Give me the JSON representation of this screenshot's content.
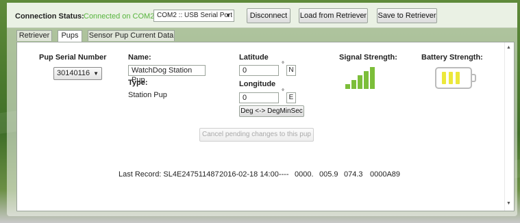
{
  "connection": {
    "label": "Connection Status:",
    "status": "Connected on COM2",
    "port": "COM2 :: USB Serial Port"
  },
  "toolbar": {
    "disconnect_label": "Disconnect",
    "load_label": "Load from Retriever",
    "save_label": "Save to Retriever"
  },
  "tabs": [
    {
      "label": "Retriever",
      "active": false
    },
    {
      "label": "Pups",
      "active": true
    },
    {
      "label": "Sensor Pup Current Data",
      "active": false
    }
  ],
  "pup": {
    "serial_label": "Pup Serial Number",
    "serial_value": "30140116",
    "name_label": "Name:",
    "name_value": "WatchDog Station Pup",
    "type_label": "Type:",
    "type_value": "Station Pup",
    "latitude_label": "Latitude",
    "latitude_value": "0",
    "latitude_dir": "N",
    "longitude_label": "Longitude",
    "longitude_value": "0",
    "longitude_dir": "E",
    "degree_symbol": "°",
    "convert_label": "Deg <-> DegMinSec",
    "signal_label": "Signal Strength:",
    "battery_label": "Battery Strength:",
    "signal_level": "5/5",
    "battery_level": "3/3",
    "cancel_label": "Cancel pending changes to this pup"
  },
  "last_record": {
    "label": "Last Record: SL4E247511487",
    "timestamp": "2016-02-18 14:00----",
    "v1": "0000.",
    "v2": "005.9",
    "v3": "074.3",
    "v4": "0000A89"
  },
  "colors": {
    "connected": "#56b43c",
    "signal": "#7cbe3a",
    "battery": "#ece83a"
  }
}
